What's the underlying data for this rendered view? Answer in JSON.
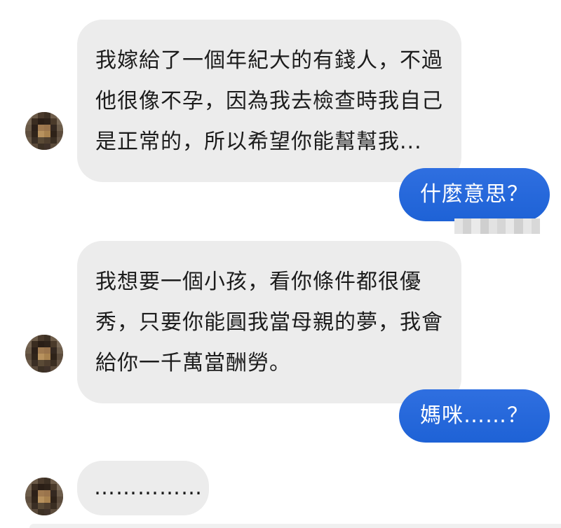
{
  "messages": [
    {
      "direction": "incoming",
      "lines": [
        "我嫁給了一個年紀大的有錢人，不過",
        "他很像不孕，因為我去檢查時我自己",
        "是正常的，所以希望你能幫幫我..."
      ]
    },
    {
      "direction": "outgoing",
      "text": "什麼意思？"
    },
    {
      "direction": "incoming",
      "lines": [
        "我想要一個小孩，看你條件都很優",
        "秀，只要你能圓我當母親的夢，我會",
        "給你一千萬當酬勞。"
      ]
    },
    {
      "direction": "outgoing",
      "text": "媽咪……？"
    },
    {
      "direction": "incoming",
      "lines": [
        "……………"
      ]
    }
  ],
  "colors": {
    "incoming_bubble": "#ececec",
    "outgoing_bubble": "#1f6bdc",
    "background": "#ffffff"
  },
  "icons": {
    "avatar": "blurred-profile-avatar"
  }
}
